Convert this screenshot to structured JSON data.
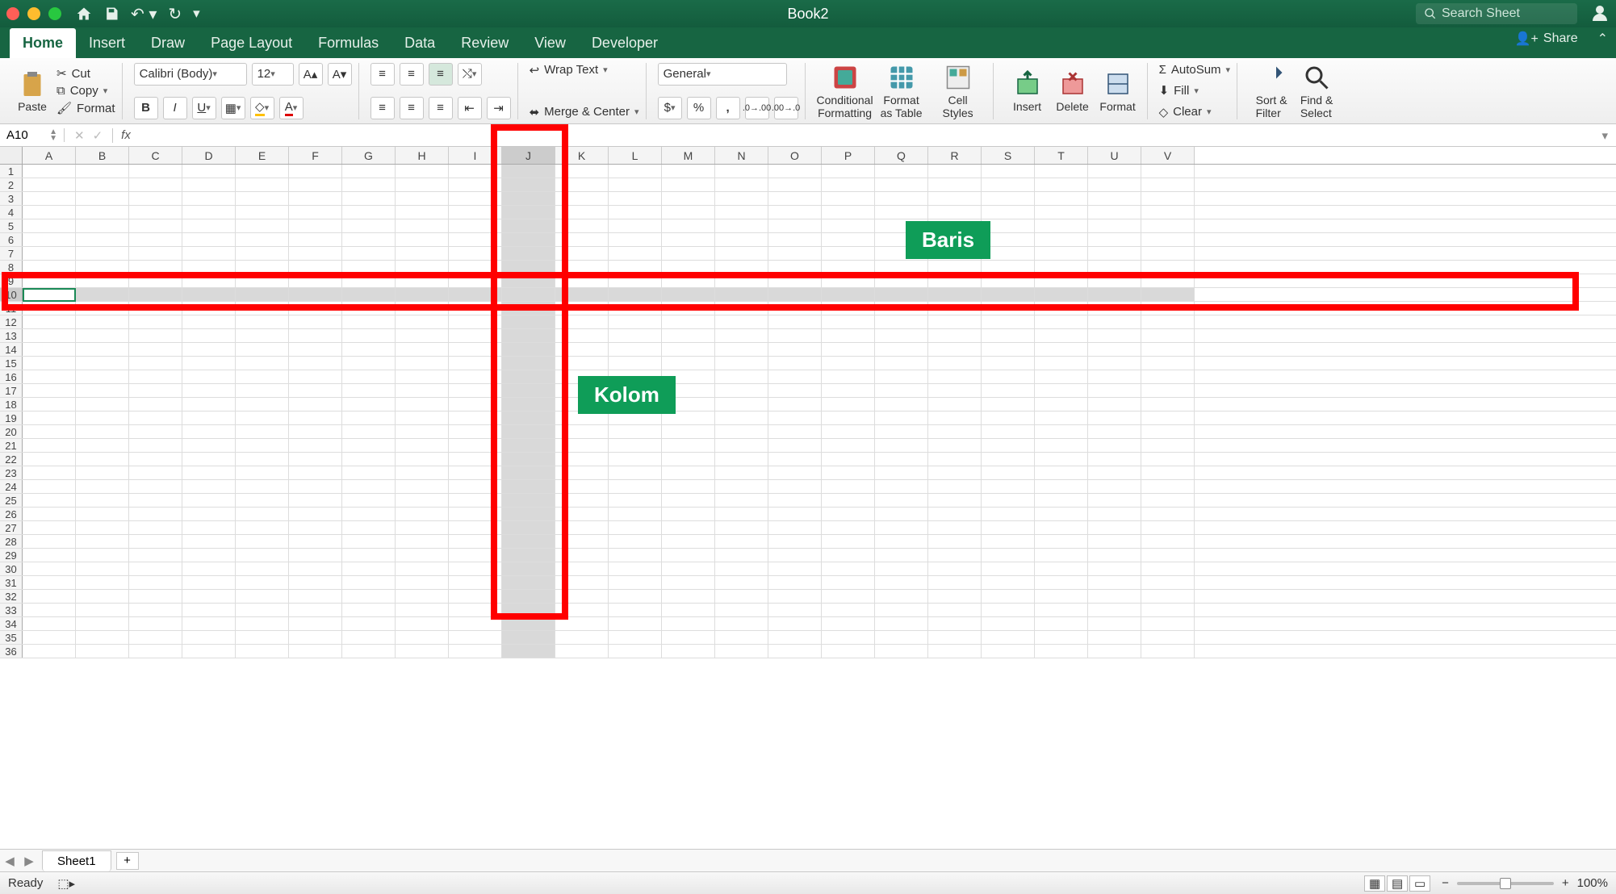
{
  "title": "Book2",
  "search_placeholder": "Search Sheet",
  "share_label": "Share",
  "tabs": [
    "Home",
    "Insert",
    "Draw",
    "Page Layout",
    "Formulas",
    "Data",
    "Review",
    "View",
    "Developer"
  ],
  "clipboard": {
    "paste": "Paste",
    "cut": "Cut",
    "copy": "Copy",
    "format": "Format"
  },
  "font": {
    "name": "Calibri (Body)",
    "size": "12"
  },
  "align": {
    "wrap": "Wrap Text",
    "merge": "Merge & Center"
  },
  "number": {
    "format": "General"
  },
  "styles": {
    "cf": "Conditional\nFormatting",
    "fat": "Format\nas Table",
    "cs": "Cell\nStyles"
  },
  "cells": {
    "insert": "Insert",
    "delete": "Delete",
    "format": "Format"
  },
  "editing": {
    "autosum": "AutoSum",
    "fill": "Fill",
    "clear": "Clear",
    "sort": "Sort &\nFilter",
    "find": "Find &\nSelect"
  },
  "namebox": "A10",
  "fx": "fx",
  "columns": [
    "A",
    "B",
    "C",
    "D",
    "E",
    "F",
    "G",
    "H",
    "I",
    "J",
    "K",
    "L",
    "M",
    "N",
    "O",
    "P",
    "Q",
    "R",
    "S",
    "T",
    "U",
    "V"
  ],
  "selected_col": "J",
  "rows_count": 36,
  "selected_row": 10,
  "sheet": "Sheet1",
  "status": "Ready",
  "zoom": "100%",
  "labels": {
    "baris": "Baris",
    "kolom": "Kolom"
  }
}
